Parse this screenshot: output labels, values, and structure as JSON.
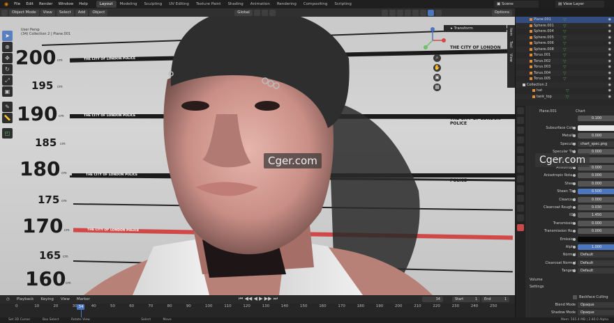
{
  "menu": [
    "File",
    "Edit",
    "Render",
    "Window",
    "Help"
  ],
  "workspaces": [
    "Layout",
    "Modeling",
    "Sculpting",
    "UV Editing",
    "Texture Paint",
    "Shading",
    "Animation",
    "Rendering",
    "Compositing",
    "Scripting"
  ],
  "scene": "Scene",
  "view_layer": "View Layer",
  "header": {
    "mode": "Object Mode",
    "view": "View",
    "select": "Select",
    "add": "Add",
    "object": "Object",
    "orientation": "Global",
    "options": "Options"
  },
  "viewport": {
    "info_line1": "User Persp",
    "info_line2": "(34) Collection 2 | Plane.001",
    "transform_label": "Transform",
    "side_tabs": [
      "Item",
      "Tool",
      "View"
    ],
    "heights": [
      "200",
      "195",
      "190",
      "185",
      "180",
      "175",
      "170",
      "165",
      "160"
    ],
    "cm": "cm",
    "police_text": "THE CITY OF LONDON POLICE",
    "watermark": "Cger.com"
  },
  "timeline": {
    "menus": [
      "Playback",
      "Keying",
      "View",
      "Marker"
    ],
    "current_frame": "34",
    "start_label": "Start",
    "start": "1",
    "end_label": "End",
    "end": "1",
    "ticks": [
      "0",
      "10",
      "20",
      "30",
      "40",
      "50",
      "60",
      "70",
      "80",
      "90",
      "100",
      "110",
      "120",
      "130",
      "140",
      "150",
      "160",
      "170",
      "180",
      "190",
      "200",
      "210",
      "220",
      "230",
      "240",
      "250"
    ]
  },
  "statusbar": {
    "left": "Set 3D Cursor",
    "box": "Box Select",
    "rotate": "Rotate View",
    "select": "Select",
    "move": "Move",
    "right": "Mem: 565.4 MB | 2.80.0 Alpha"
  },
  "outliner": {
    "items": [
      {
        "name": "Plane.001",
        "selected": true
      },
      {
        "name": "Sphere.001"
      },
      {
        "name": "Sphere.004"
      },
      {
        "name": "Sphere.005"
      },
      {
        "name": "Sphere.006"
      },
      {
        "name": "Sphere.008"
      },
      {
        "name": "Torus.001"
      },
      {
        "name": "Torus.002"
      },
      {
        "name": "Torus.003"
      },
      {
        "name": "Torus.004"
      },
      {
        "name": "Torus.005"
      },
      {
        "name": "Collection 2"
      },
      {
        "name": "hat"
      },
      {
        "name": "tank_top"
      }
    ]
  },
  "properties": {
    "object": "Plane.001",
    "material": "Chart",
    "top_value": "0.100",
    "rows": [
      {
        "label": "Subsurface Color",
        "value": "",
        "kind": "color"
      },
      {
        "label": "Metallic",
        "value": "0.000"
      },
      {
        "label": "Specular",
        "value": "chart_spec.png",
        "kind": "dark"
      },
      {
        "label": "Specular Tint",
        "value": "0.000"
      },
      {
        "label": "Roughness",
        "value": ""
      },
      {
        "label": "Anisotropic",
        "value": "0.000"
      },
      {
        "label": "Anisotropic Rota...",
        "value": "0.000"
      },
      {
        "label": "Sheen",
        "value": "0.000"
      },
      {
        "label": "Sheen Tint",
        "value": "0.500",
        "kind": "blue"
      },
      {
        "label": "Clearcoat",
        "value": "0.000"
      },
      {
        "label": "Clearcoat Rough...",
        "value": "0.030"
      },
      {
        "label": "IOR",
        "value": "1.450"
      },
      {
        "label": "Transmission",
        "value": "0.000"
      },
      {
        "label": "Transmission Ro...",
        "value": "0.000"
      },
      {
        "label": "Emission",
        "value": "",
        "kind": "black"
      },
      {
        "label": "Alpha",
        "value": "1.000",
        "kind": "blue"
      },
      {
        "label": "Normal",
        "value": "Default",
        "kind": "dark"
      },
      {
        "label": "Clearcoat Normal",
        "value": "Default",
        "kind": "dark"
      },
      {
        "label": "Tangent",
        "value": "Default",
        "kind": "dark"
      }
    ],
    "volume": "Volume",
    "settings": "Settings",
    "backface": "Backface Culling",
    "blend_label": "Blend Mode",
    "blend": "Opaque",
    "shadow_label": "Shadow Mode",
    "shadow": "Opaque"
  },
  "colors": {
    "accent": "#4d76c2",
    "police_red": "#d04848",
    "object_green": "#4ca64c"
  }
}
